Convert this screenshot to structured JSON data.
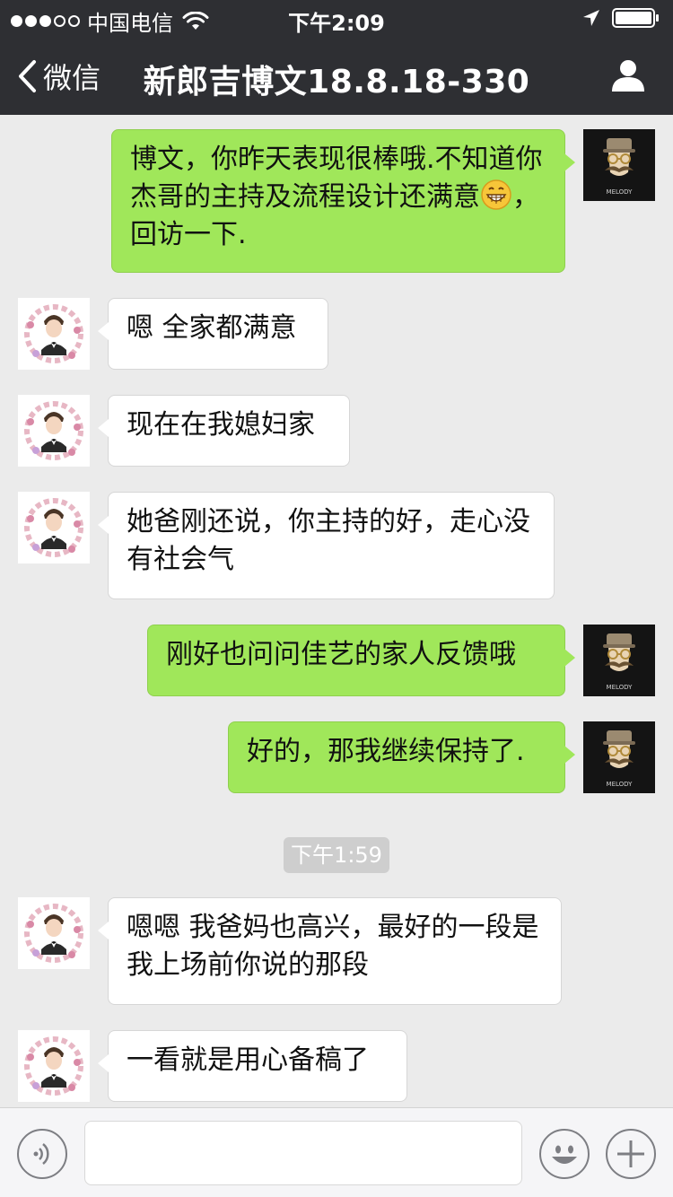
{
  "status_bar": {
    "carrier": "中国电信",
    "time": "下午2:09"
  },
  "nav": {
    "back_label": "微信",
    "title": "新郎吉博文18.8.18-330"
  },
  "messages": [
    {
      "side": "mine",
      "text_before": "博文，你昨天表现很棒哦.不知道你杰哥的主持及流程设计还满意",
      "emoji": "grin-emoji",
      "text_after": "，回访一下."
    },
    {
      "side": "theirs",
      "text": "嗯 全家都满意"
    },
    {
      "side": "theirs",
      "text": "现在在我媳妇家"
    },
    {
      "side": "theirs",
      "text": "她爸刚还说，你主持的好，走心没有社会气"
    },
    {
      "side": "mine",
      "text": "刚好也问问佳艺的家人反馈哦"
    },
    {
      "side": "mine",
      "text": "好的，那我继续保持了."
    },
    {
      "side": "theirs",
      "text": "嗯嗯 我爸妈也高兴，最好的一段是我上场前你说的那段"
    },
    {
      "side": "theirs",
      "text": "一看就是用心备稿了"
    }
  ],
  "timestamp": "下午1:59",
  "avatar_badge": "MELODY",
  "colors": {
    "nav_bg": "#2e2f33",
    "chat_bg": "#ebebeb",
    "my_bubble": "#a0e75a",
    "their_bubble": "#ffffff"
  }
}
